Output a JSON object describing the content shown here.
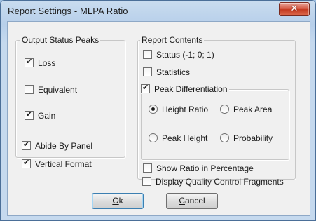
{
  "window": {
    "title": "Report Settings - MLPA Ratio",
    "close_glyph": "✕",
    "close_icon": "close-icon"
  },
  "output_status_peaks": {
    "legend": "Output Status Peaks",
    "items": [
      {
        "label": "Loss",
        "checked": true
      },
      {
        "label": "Equivalent",
        "checked": false
      },
      {
        "label": "Gain",
        "checked": true
      }
    ]
  },
  "options": {
    "abide_by_panel": {
      "label": "Abide By Panel",
      "checked": true
    },
    "vertical_format": {
      "label": "Vertical Format",
      "checked": true
    }
  },
  "report_contents": {
    "legend": "Report Contents",
    "status": {
      "label": "Status (-1; 0; 1)",
      "checked": false
    },
    "statistics": {
      "label": "Statistics",
      "checked": false
    },
    "peak_differentiation": {
      "label": "Peak Differentiation",
      "checked": true,
      "radios": [
        {
          "label": "Height Ratio",
          "selected": true
        },
        {
          "label": "Peak Area",
          "selected": false
        },
        {
          "label": "Peak Height",
          "selected": false
        },
        {
          "label": "Probability",
          "selected": false
        }
      ]
    },
    "show_ratio": {
      "label": "Show Ratio in Percentage",
      "checked": false
    },
    "display_qc": {
      "label": "Display Quality Control Fragments",
      "checked": false
    }
  },
  "buttons": {
    "ok": {
      "label": "Ok",
      "accel": "O"
    },
    "cancel": {
      "label": "Cancel",
      "accel": "C"
    }
  }
}
